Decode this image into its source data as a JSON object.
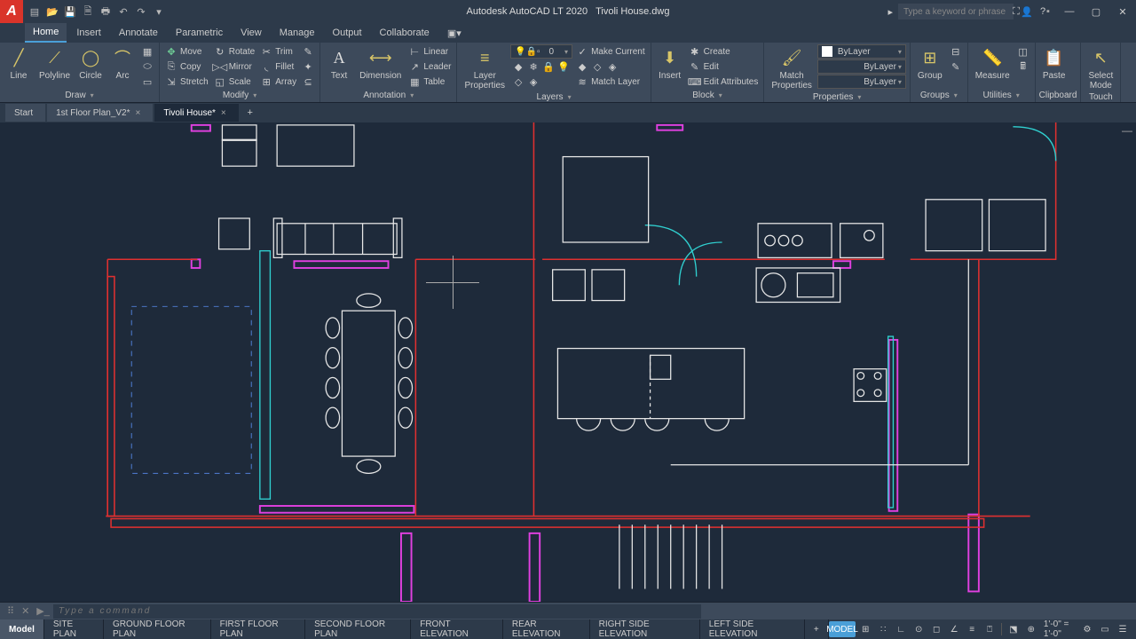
{
  "app": {
    "name": "Autodesk AutoCAD LT 2020",
    "file": "Tivoli House.dwg",
    "search_ph": "Type a keyword or phrase"
  },
  "menus": [
    "Home",
    "Insert",
    "Annotate",
    "Parametric",
    "View",
    "Manage",
    "Output",
    "Collaborate"
  ],
  "menu_active": 0,
  "ribbon": {
    "draw": {
      "label": "Draw",
      "line": "Line",
      "polyline": "Polyline",
      "circle": "Circle",
      "arc": "Arc"
    },
    "modify": {
      "label": "Modify",
      "move": "Move",
      "rotate": "Rotate",
      "trim": "Trim",
      "copy": "Copy",
      "mirror": "Mirror",
      "fillet": "Fillet",
      "stretch": "Stretch",
      "scale": "Scale",
      "array": "Array"
    },
    "annotation": {
      "label": "Annotation",
      "text": "Text",
      "dim": "Dimension",
      "linear": "Linear",
      "leader": "Leader",
      "table": "Table"
    },
    "layers": {
      "label": "Layers",
      "props": "Layer\nProperties",
      "make": "Make Current",
      "match": "Match Layer",
      "current": "0"
    },
    "block": {
      "label": "Block",
      "insert": "Insert",
      "create": "Create",
      "edit": "Edit",
      "editattr": "Edit Attributes"
    },
    "properties": {
      "label": "Properties",
      "match": "Match\nProperties",
      "layer": "ByLayer",
      "lw": "ByLayer",
      "lt": "ByLayer"
    },
    "groups": {
      "label": "Groups",
      "group": "Group"
    },
    "utilities": {
      "label": "Utilities",
      "measure": "Measure"
    },
    "clipboard": {
      "label": "Clipboard",
      "paste": "Paste"
    },
    "touch": {
      "label": "Touch",
      "select": "Select\nMode"
    }
  },
  "file_tabs": [
    {
      "label": "Start",
      "closable": false
    },
    {
      "label": "1st Floor Plan_V2*",
      "closable": true
    },
    {
      "label": "Tivoli House*",
      "closable": true,
      "active": true
    }
  ],
  "cmd_ph": "Type a command",
  "layouts": [
    "Model",
    "SITE PLAN",
    "GROUND FLOOR PLAN",
    "FIRST FLOOR PLAN",
    "SECOND FLOOR PLAN",
    "FRONT  ELEVATION",
    "REAR  ELEVATION",
    "RIGHT SIDE ELEVATION",
    "LEFT SIDE  ELEVATION"
  ],
  "layout_active": 0,
  "status": {
    "model": "MODEL",
    "scale": "1'-0\" = 1'-0\""
  }
}
